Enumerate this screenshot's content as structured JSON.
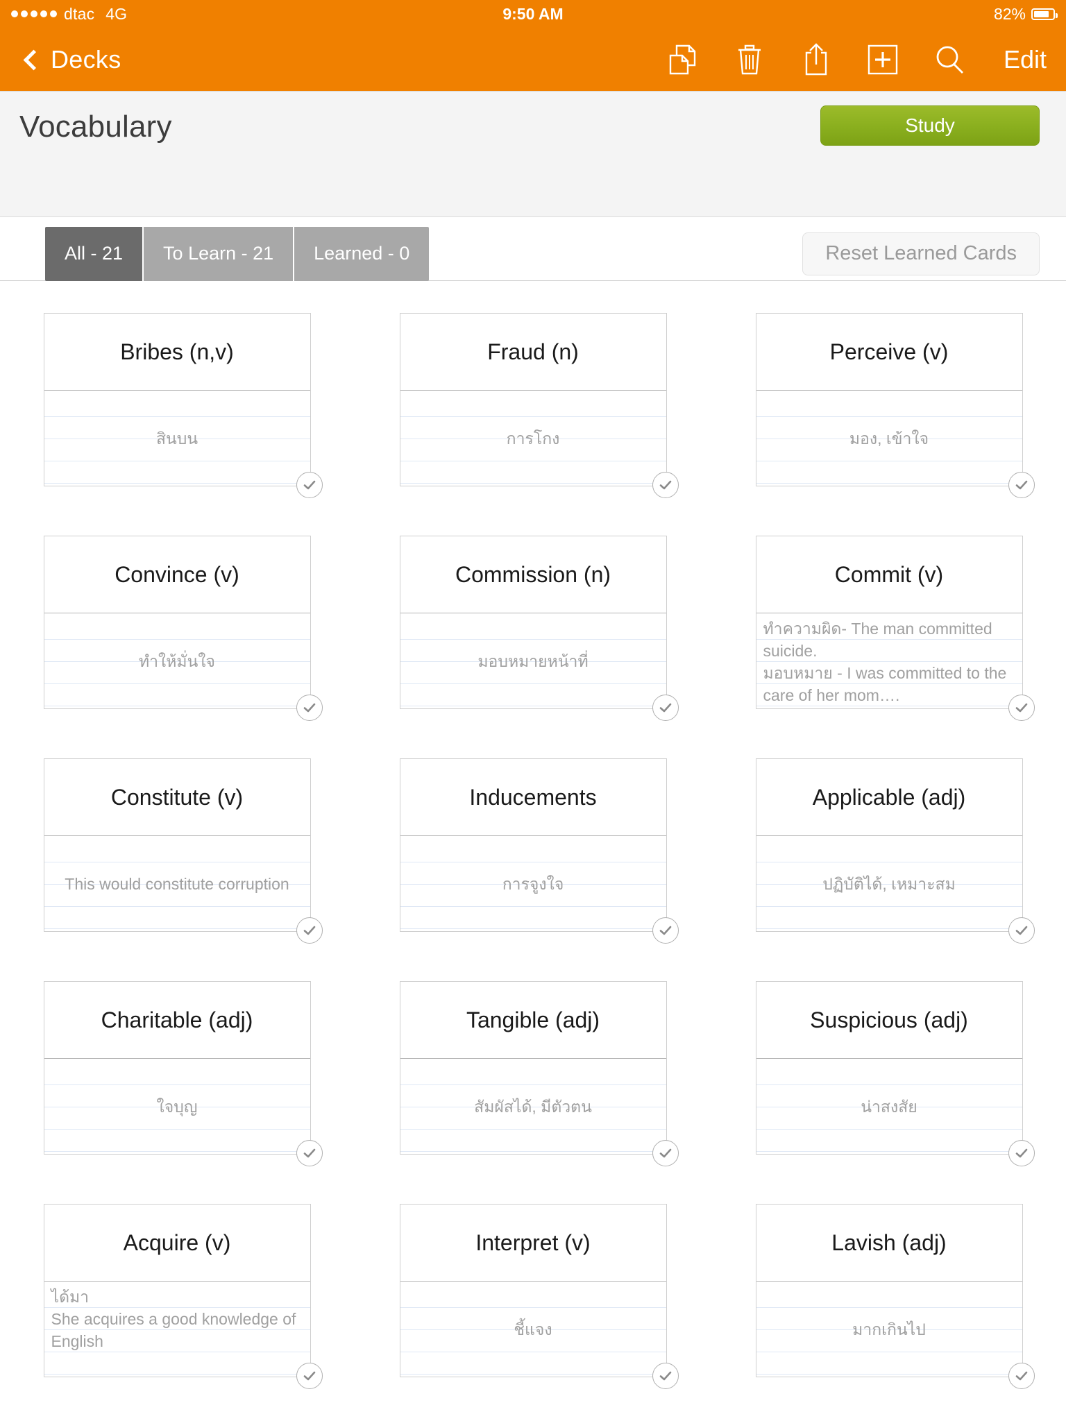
{
  "status_bar": {
    "carrier": "dtac",
    "network": "4G",
    "time": "9:50 AM",
    "battery_percent": "82%",
    "signal_dots": 5
  },
  "nav_bar": {
    "back_label": "Decks",
    "edit_label": "Edit",
    "icons": [
      "duplicate-icon",
      "trash-icon",
      "share-icon",
      "add-icon",
      "search-icon"
    ]
  },
  "header": {
    "deck_title": "Vocabulary",
    "study_label": "Study",
    "study_color": "#8bb01f",
    "bar_color": "#F08000"
  },
  "filter_bar": {
    "segments": [
      {
        "label": "All - 21",
        "active": true
      },
      {
        "label": "To Learn - 21",
        "active": false
      },
      {
        "label": "Learned - 0",
        "active": false
      }
    ],
    "reset_label": "Reset Learned Cards"
  },
  "cards": [
    {
      "term": "Bribes (n,v)",
      "back": "สินบน",
      "multiline": false,
      "learned_badge": true
    },
    {
      "term": "Fraud (n)",
      "back": "การโกง",
      "multiline": false,
      "learned_badge": true
    },
    {
      "term": "Perceive (v)",
      "back": "มอง, เข้าใจ",
      "multiline": false,
      "learned_badge": true
    },
    {
      "term": "Convince (v)",
      "back": "ทำให้มั่นใจ",
      "multiline": false,
      "learned_badge": true
    },
    {
      "term": "Commission (n)",
      "back": "มอบหมายหน้าที่",
      "multiline": false,
      "learned_badge": true
    },
    {
      "term": "Commit (v)",
      "back": "ทำความผิด- The man committed suicide.\nมอบหมาย - I was committed to the care of her mom….",
      "multiline": true,
      "learned_badge": true
    },
    {
      "term": "Constitute (v)",
      "back": "This would constitute corruption",
      "multiline": false,
      "learned_badge": true
    },
    {
      "term": "Inducements",
      "back": "การจูงใจ",
      "multiline": false,
      "learned_badge": true
    },
    {
      "term": "Applicable (adj)",
      "back": "ปฏิบัติได้, เหมาะสม",
      "multiline": false,
      "learned_badge": true
    },
    {
      "term": "Charitable (adj)",
      "back": "ใจบุญ",
      "multiline": false,
      "learned_badge": true
    },
    {
      "term": "Tangible (adj)",
      "back": "สัมผัสได้, มีตัวตน",
      "multiline": false,
      "learned_badge": true
    },
    {
      "term": "Suspicious (adj)",
      "back": "น่าสงสัย",
      "multiline": false,
      "learned_badge": true
    },
    {
      "term": "Acquire (v)",
      "back": "ได้มา\nShe acquires a good knowledge of English",
      "multiline": true,
      "learned_badge": true
    },
    {
      "term": "Interpret (v)",
      "back": "ชี้แจง",
      "multiline": false,
      "learned_badge": true
    },
    {
      "term": "Lavish (adj)",
      "back": "มากเกินไป",
      "multiline": false,
      "learned_badge": true
    }
  ]
}
